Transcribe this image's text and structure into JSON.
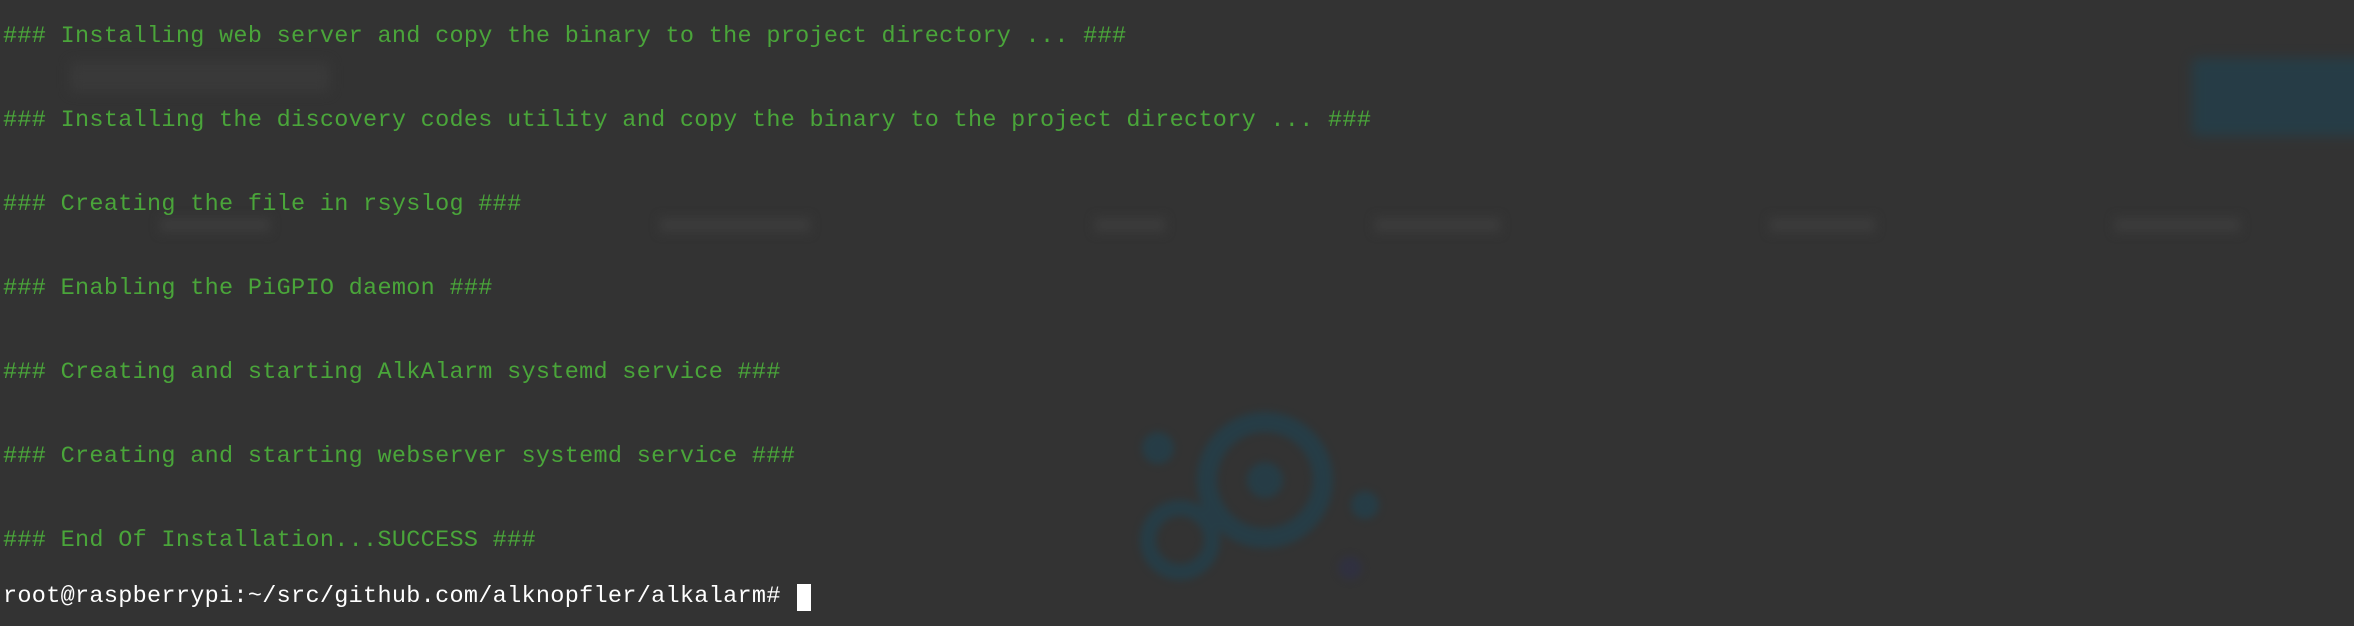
{
  "colors": {
    "background": "#333333",
    "output_text": "#4aa53a",
    "prompt_text": "#ffffff"
  },
  "terminal": {
    "output_lines": [
      "### Installing web server and copy the binary to the project directory ... ###",
      "### Installing the discovery codes utility and copy the binary to the project directory ... ###",
      "### Creating the file in rsyslog ###",
      "### Enabling the PiGPIO daemon ###",
      "### Creating and starting AlkAlarm systemd service ###",
      "### Creating and starting webserver systemd service ###",
      "### End Of Installation...SUCCESS ###"
    ],
    "prompt": "root@raspberrypi:~/src/github.com/alknopfler/alkalarm#"
  }
}
